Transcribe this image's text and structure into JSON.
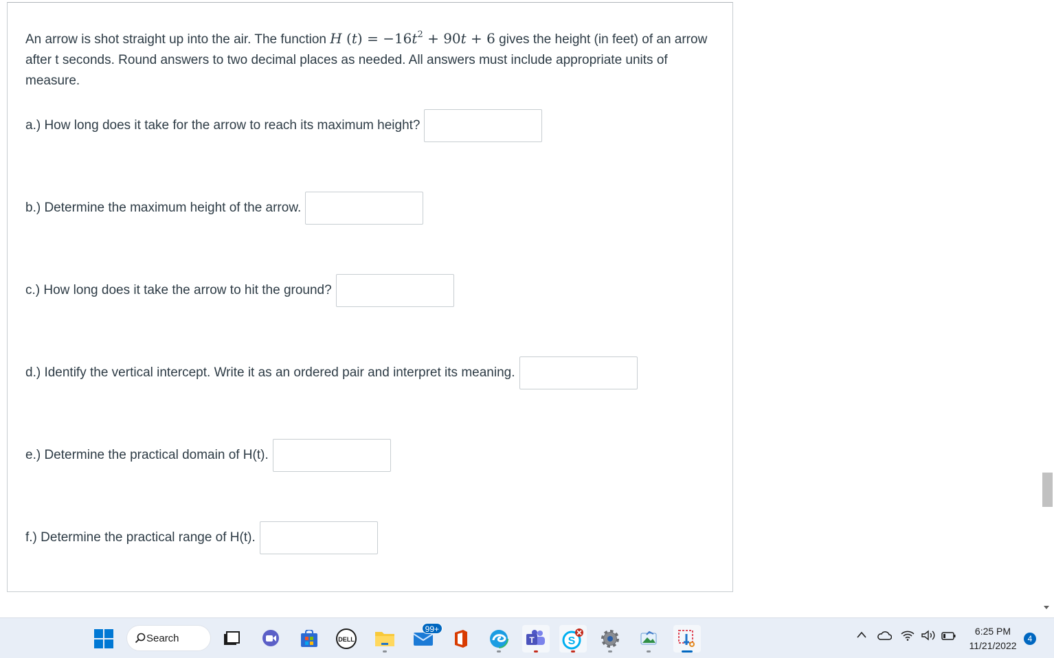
{
  "problem": {
    "intro_before": "An arrow is shot straight up into the air. The function ",
    "function_lhs": "H",
    "function_var": "t",
    "function_eq": " = −16",
    "function_t": "t",
    "function_exp": "2",
    "function_rest1": " + 90",
    "function_t2": "t",
    "function_rest2": " + 6",
    "intro_after": " gives the height (in feet) of an arrow after t seconds. Round answers to two decimal places as needed. All answers must include appropriate units of measure."
  },
  "questions": [
    {
      "label": "a.) How long does it take for the arrow to reach its maximum height?",
      "value": ""
    },
    {
      "label": "b.) Determine the maximum height of the arrow.",
      "value": ""
    },
    {
      "label": "c.) How long does it take the arrow to hit the ground?",
      "value": ""
    },
    {
      "label": "d.) Identify the vertical intercept. Write it as an ordered pair and interpret its meaning.",
      "value": ""
    },
    {
      "label": "e.) Determine the practical domain of H(t).",
      "value": ""
    },
    {
      "label": "f.) Determine the practical range of H(t).",
      "value": ""
    }
  ],
  "taskbar": {
    "search_label": "Search",
    "mail_badge": "99+",
    "time": "6:25 PM",
    "date": "11/21/2022",
    "notification_count": "4",
    "icons": [
      "windows-start-icon",
      "search-icon",
      "task-view-icon",
      "chat-icon",
      "microsoft-store-icon",
      "dell-icon",
      "file-explorer-icon",
      "mail-icon",
      "office-icon",
      "edge-icon",
      "teams-icon",
      "skype-icon",
      "settings-icon",
      "photos-icon",
      "snipping-tool-icon",
      "chevron-up-icon",
      "onedrive-icon",
      "wifi-icon",
      "volume-icon",
      "battery-icon"
    ]
  }
}
